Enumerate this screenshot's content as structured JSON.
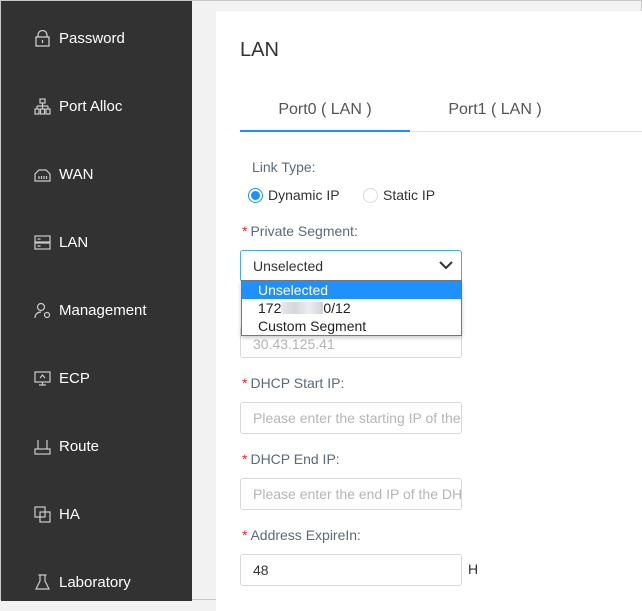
{
  "sidebar": {
    "items": [
      {
        "label": "Password",
        "icon": "lock-icon"
      },
      {
        "label": "Port Alloc",
        "icon": "network-icon"
      },
      {
        "label": "WAN",
        "icon": "ethernet-port-icon"
      },
      {
        "label": "LAN",
        "icon": "server-icon"
      },
      {
        "label": "Management",
        "icon": "user-gear-icon"
      },
      {
        "label": "ECP",
        "icon": "monitor-icon"
      },
      {
        "label": "Route",
        "icon": "router-icon"
      },
      {
        "label": "HA",
        "icon": "copy-icon"
      },
      {
        "label": "Laboratory",
        "icon": "flask-icon"
      }
    ]
  },
  "main": {
    "title": "LAN",
    "tabs": [
      {
        "label": "Port0 ( LAN )"
      },
      {
        "label": "Port1 ( LAN )"
      }
    ],
    "link_type": {
      "label": "Link Type:",
      "options": [
        "Dynamic IP",
        "Static IP"
      ],
      "selected": "Dynamic IP"
    },
    "private_segment": {
      "label": "Private Segment:",
      "value": "Unselected",
      "options": [
        "Unselected",
        "172",
        "0/12",
        "Custom Segment"
      ]
    },
    "gateway_value": "30.43.125.41",
    "dhcp_start": {
      "label": "DHCP Start IP:",
      "placeholder": "Please enter the starting IP of the DHCP"
    },
    "dhcp_end": {
      "label": "DHCP End IP:",
      "placeholder": "Please enter the end IP of the DHCP"
    },
    "expire": {
      "label": "Address ExpireIn:",
      "value": "48",
      "unit": "H"
    }
  },
  "colors": {
    "accent": "#1890ff",
    "sidebar": "#323232",
    "required": "#f5222d"
  }
}
